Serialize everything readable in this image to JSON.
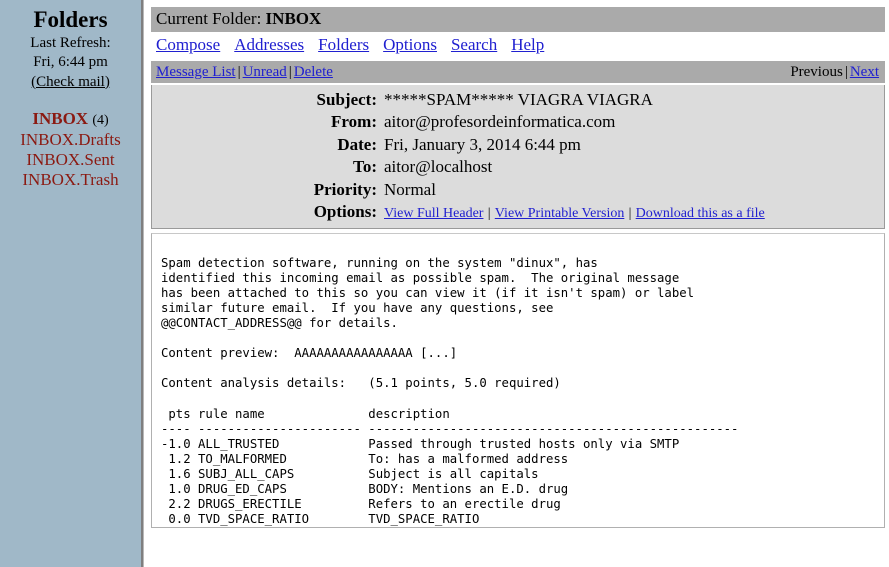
{
  "sidebar": {
    "title": "Folders",
    "refresh_label": "Last Refresh:",
    "refresh_time": "Fri, 6:44 pm",
    "check_mail_label": "(Check mail)",
    "folders": [
      {
        "name": "INBOX",
        "count": "(4)",
        "bold": true
      },
      {
        "name": "INBOX.Drafts",
        "count": "",
        "bold": false
      },
      {
        "name": "INBOX.Sent",
        "count": "",
        "bold": false
      },
      {
        "name": "INBOX.Trash",
        "count": "",
        "bold": false
      }
    ]
  },
  "folder_bar": {
    "prefix": "Current Folder:",
    "folder": "INBOX"
  },
  "menu": {
    "items": [
      {
        "label": "Compose"
      },
      {
        "label": "Addresses"
      },
      {
        "label": "Folders"
      },
      {
        "label": "Options"
      },
      {
        "label": "Search"
      },
      {
        "label": "Help"
      }
    ]
  },
  "action_bar": {
    "message_list": "Message List",
    "sep1": "|",
    "unread": "Unread",
    "sep2": "|",
    "delete": "Delete",
    "previous": "Previous",
    "sep3": "|",
    "next": "Next"
  },
  "message": {
    "subject_label": "Subject:",
    "subject": "*****SPAM***** VIAGRA VIAGRA",
    "from_label": "From:",
    "from": "aitor@profesordeinformatica.com",
    "date_label": "Date:",
    "date": "Fri, January 3, 2014 6:44 pm",
    "to_label": "To:",
    "to": "aitor@localhost",
    "priority_label": "Priority:",
    "priority": "Normal",
    "options_label": "Options:",
    "options": {
      "view_full_header": "View Full Header",
      "sep1": "|",
      "view_printable": "View Printable Version",
      "sep2": "|",
      "download": "Download this as a file"
    },
    "body": "Spam detection software, running on the system \"dinux\", has\nidentified this incoming email as possible spam.  The original message\nhas been attached to this so you can view it (if it isn't spam) or label\nsimilar future email.  If you have any questions, see\n@@CONTACT_ADDRESS@@ for details.\n\nContent preview:  AAAAAAAAAAAAAAAA [...]\n\nContent analysis details:   (5.1 points, 5.0 required)\n\n pts rule name              description\n---- ---------------------- --------------------------------------------------\n-1.0 ALL_TRUSTED            Passed through trusted hosts only via SMTP\n 1.2 TO_MALFORMED           To: has a malformed address\n 1.6 SUBJ_ALL_CAPS          Subject is all capitals\n 1.0 DRUG_ED_CAPS           BODY: Mentions an E.D. drug\n 2.2 DRUGS_ERECTILE         Refers to an erectile drug\n 0.0 TVD_SPACE_RATIO        TVD_SPACE_RATIO"
  },
  "colors": {
    "sidebar_bg": "#a0b8c8",
    "folder_link": "#8b1a12",
    "link": "#2020d0",
    "bar_bg": "#aaaaaa",
    "header_bg": "#dcdcdc"
  }
}
